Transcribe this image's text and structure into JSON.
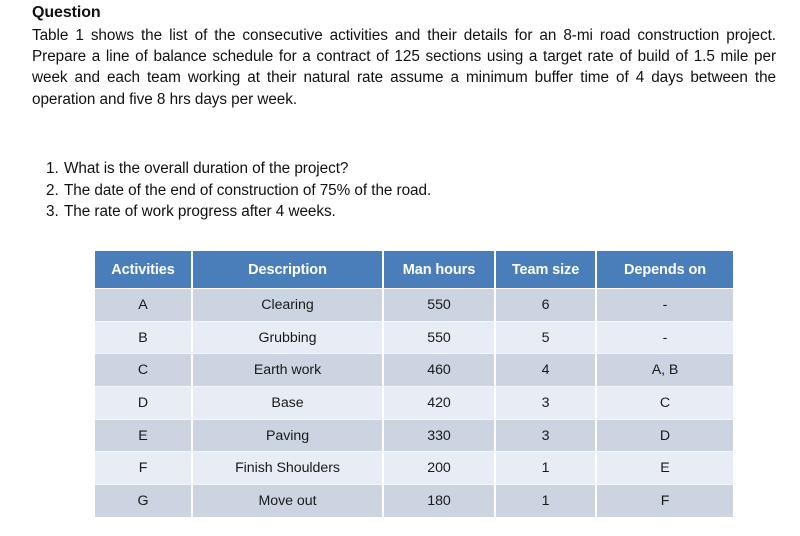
{
  "document": {
    "heading": "Question",
    "paragraph": "Table 1 shows the list of the consecutive activities and their details for an 8-mi road construction project. Prepare a line of balance schedule for a contract of 125 sections using a target rate of build of 1.5 mile per week and each team working at their natural rate assume a minimum buffer time of 4 days between the operation and five 8 hrs days per week.",
    "questions": [
      {
        "number": "1.",
        "text": "What is the overall duration of the project?"
      },
      {
        "number": "2.",
        "text": "The date of the end of construction of 75% of the road."
      },
      {
        "number": "3.",
        "text": "The rate of work progress after 4 weeks."
      }
    ]
  },
  "table": {
    "headers": [
      "Activities",
      "Description",
      "Man hours",
      "Team size",
      "Depends on"
    ],
    "rows": [
      {
        "activity": "A",
        "description": "Clearing",
        "man_hours": "550",
        "team_size": "6",
        "depends_on": "-"
      },
      {
        "activity": "B",
        "description": "Grubbing",
        "man_hours": "550",
        "team_size": "5",
        "depends_on": "-"
      },
      {
        "activity": "C",
        "description": "Earth work",
        "man_hours": "460",
        "team_size": "4",
        "depends_on": "A, B"
      },
      {
        "activity": "D",
        "description": "Base",
        "man_hours": "420",
        "team_size": "3",
        "depends_on": "C"
      },
      {
        "activity": "E",
        "description": "Paving",
        "man_hours": "330",
        "team_size": "3",
        "depends_on": "D"
      },
      {
        "activity": "F",
        "description": "Finish Shoulders",
        "man_hours": "200",
        "team_size": "1",
        "depends_on": "E"
      },
      {
        "activity": "G",
        "description": "Move out",
        "man_hours": "180",
        "team_size": "1",
        "depends_on": "F"
      }
    ]
  },
  "colors": {
    "header_background": "#4a7ebb",
    "header_text": "#ffffff",
    "row_odd": "#ccd3e1",
    "row_even": "#e8ecf4",
    "page_background": "#ffffff",
    "body_text": "#111111"
  }
}
